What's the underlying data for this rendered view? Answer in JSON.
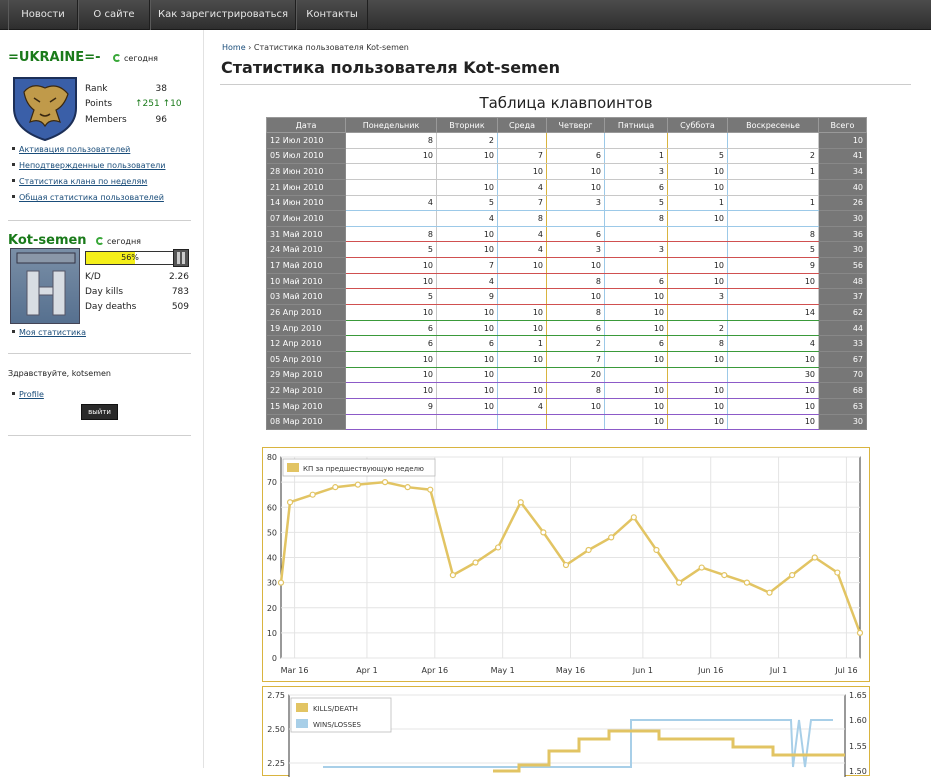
{
  "nav": {
    "items": [
      "Новости",
      "О сайте",
      "Как зарегистрироваться",
      "Контакты"
    ]
  },
  "clan": {
    "name": "=UKRAINE=-",
    "status": "сегодня",
    "rank_label": "Rank",
    "rank_value": "38",
    "points_label": "Points",
    "points_value": "↑251 ↑10",
    "members_label": "Members",
    "members_value": "96",
    "links": [
      "Активация пользователей",
      "Неподтвержденные пользователи",
      "Статистика клана по неделям",
      "Общая статистика пользователей"
    ]
  },
  "user": {
    "name": "Kot-semen",
    "status": "сегодня",
    "progress_label": "56%",
    "progress": 0.56,
    "kd_label": "K/D",
    "kd_value": "2.26",
    "kills_label": "Day kills",
    "kills_value": "783",
    "deaths_label": "Day deaths",
    "deaths_value": "509",
    "my_stats": "Моя статистика"
  },
  "account": {
    "greeting": "Здравствуйте, kotsemen",
    "profile": "Profile",
    "logout": "выйти"
  },
  "breadcrumb": {
    "home": "Home",
    "current": "Статистика пользователя Kot-semen"
  },
  "page_title": "Статистика пользователя Kot-semen",
  "table": {
    "title": "Таблица клавпоинтов",
    "headers": [
      "Дата",
      "Понедельник",
      "Вторник",
      "Среда",
      "Четверг",
      "Пятница",
      "Суббота",
      "Воскресенье",
      "Всего"
    ],
    "rows": [
      [
        "12 Июл 2010",
        "8",
        "2",
        "",
        "",
        "",
        "",
        "",
        "10"
      ],
      [
        "05 Июл 2010",
        "10",
        "10",
        "7",
        "6",
        "1",
        "5",
        "2",
        "41"
      ],
      [
        "28 Июн 2010",
        "",
        "",
        "10",
        "10",
        "3",
        "10",
        "1",
        "34"
      ],
      [
        "21 Июн 2010",
        "",
        "10",
        "4",
        "10",
        "6",
        "10",
        "",
        "40"
      ],
      [
        "14 Июн 2010",
        "4",
        "5",
        "7",
        "3",
        "5",
        "1",
        "1",
        "26"
      ],
      [
        "07 Июн 2010",
        "",
        "4",
        "8",
        "",
        "8",
        "10",
        "",
        "30"
      ],
      [
        "31 Май 2010",
        "8",
        "10",
        "4",
        "6",
        "",
        "",
        "8",
        "36"
      ],
      [
        "24 Май 2010",
        "5",
        "10",
        "4",
        "3",
        "3",
        "",
        "5",
        "30"
      ],
      [
        "17 Май 2010",
        "10",
        "7",
        "10",
        "10",
        "",
        "10",
        "9",
        "56"
      ],
      [
        "10 Май 2010",
        "10",
        "4",
        "",
        "8",
        "6",
        "10",
        "10",
        "48"
      ],
      [
        "03 Май 2010",
        "5",
        "9",
        "",
        "10",
        "10",
        "3",
        "",
        "37"
      ],
      [
        "26 Апр 2010",
        "10",
        "10",
        "10",
        "8",
        "10",
        "",
        "14",
        "62"
      ],
      [
        "19 Апр 2010",
        "6",
        "10",
        "10",
        "6",
        "10",
        "2",
        "",
        "44"
      ],
      [
        "12 Апр 2010",
        "6",
        "6",
        "1",
        "2",
        "6",
        "8",
        "4",
        "33"
      ],
      [
        "05 Апр 2010",
        "10",
        "10",
        "10",
        "7",
        "10",
        "10",
        "10",
        "67"
      ],
      [
        "29 Мар 2010",
        "10",
        "10",
        "",
        "20",
        "",
        "",
        "30",
        "70"
      ],
      [
        "22 Мар 2010",
        "10",
        "10",
        "10",
        "8",
        "10",
        "10",
        "10",
        "68"
      ],
      [
        "15 Мар 2010",
        "9",
        "10",
        "4",
        "10",
        "10",
        "10",
        "10",
        "63"
      ],
      [
        "08 Мар 2010",
        "",
        "",
        "",
        "",
        "10",
        "10",
        "10",
        "30"
      ]
    ]
  },
  "colors": {
    "chart_line": "#e2c463",
    "chart_border": "#d9b43f",
    "wins_line": "#a8cfe8",
    "progress_fill": "#f4ef1a",
    "clan_name": "#1a7a1a"
  },
  "chart_data": [
    {
      "type": "line",
      "legend": [
        "КП за предшествующую неделю"
      ],
      "ylim": [
        0,
        80
      ],
      "yticks": [
        0,
        10,
        20,
        30,
        40,
        50,
        60,
        70,
        80
      ],
      "xtick_labels": [
        "Mar 16",
        "Apr 1",
        "Apr 16",
        "May 1",
        "May 16",
        "Jun 1",
        "Jun 16",
        "Jul 1",
        "Jul 16"
      ],
      "xlim": [
        "2010-03-13",
        "2010-07-19"
      ],
      "x": [
        "2010-03-13",
        "2010-03-15",
        "2010-03-20",
        "2010-03-25",
        "2010-03-30",
        "2010-04-05",
        "2010-04-10",
        "2010-04-15",
        "2010-04-20",
        "2010-04-25",
        "2010-04-30",
        "2010-05-05",
        "2010-05-10",
        "2010-05-15",
        "2010-05-20",
        "2010-05-25",
        "2010-05-30",
        "2010-06-04",
        "2010-06-09",
        "2010-06-14",
        "2010-06-19",
        "2010-06-24",
        "2010-06-29",
        "2010-07-04",
        "2010-07-09",
        "2010-07-14",
        "2010-07-19"
      ],
      "series": [
        {
          "name": "КП за предшествующую неделю",
          "values": [
            30,
            62,
            65,
            68,
            69,
            70,
            68,
            67,
            33,
            38,
            44,
            62,
            50,
            37,
            43,
            48,
            56,
            43,
            30,
            36,
            33,
            30,
            26,
            33,
            40,
            34,
            10
          ]
        }
      ],
      "grid": true,
      "legend_position": "top-left"
    },
    {
      "type": "line",
      "legend": [
        "KILLS/DEATH",
        "WINS/LOSSES"
      ],
      "yticks_left": [
        2.25,
        2.5,
        2.75
      ],
      "yticks_right": [
        1.5,
        1.55,
        1.6,
        1.65
      ],
      "grid": true,
      "legend_position": "top-left"
    }
  ]
}
